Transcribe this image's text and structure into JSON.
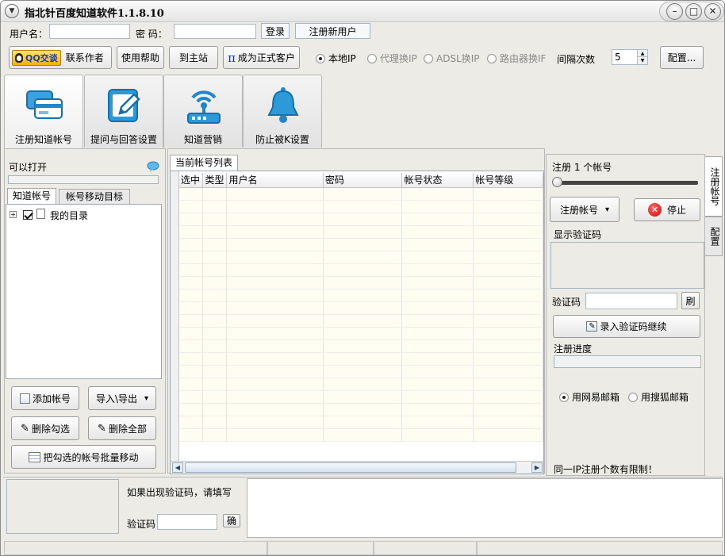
{
  "window": {
    "title": "指北针百度知道软件1.1.8.10"
  },
  "login": {
    "username_label": "用户名：",
    "username_value": "",
    "password_label": "密  码：",
    "password_value": "",
    "login_button": "登录",
    "register_button": "注册新用户"
  },
  "toolbar": {
    "qq_label": "QQ交谈",
    "contact_label": "联系作者",
    "help_button": "使用帮助",
    "home_button": "到主站",
    "pi_symbol": "π",
    "vip_button": "成为正式客户",
    "ip_options": [
      "本地IP",
      "代理换IP",
      "ADSL换IP",
      "路由器换IF"
    ],
    "interval_label": "间隔次数",
    "interval_value": "5",
    "config_button": "配置..."
  },
  "bigtabs": [
    {
      "label": "注册知道帐号",
      "icon": "card-icon"
    },
    {
      "label": "提问与回答设置",
      "icon": "edit-icon"
    },
    {
      "label": "知道营销",
      "icon": "wifi-router-icon"
    },
    {
      "label": "防止被K设置",
      "icon": "bell-icon"
    }
  ],
  "left": {
    "status_label": "可以打开",
    "tabs": [
      "知道帐号",
      "帐号移动目标"
    ],
    "tree_root": "我的目录",
    "add_button": "添加帐号",
    "import_button": "导入\\导出",
    "delete_checked_button": "删除勾选",
    "delete_all_button": "删除全部",
    "move_button": "把勾选的帐号批量移动"
  },
  "center": {
    "tab_label": "当前帐号列表",
    "columns": [
      "选中",
      "类型",
      "用户名",
      "密码",
      "帐号状态",
      "帐号等级"
    ]
  },
  "right": {
    "register_count_label": "注册 1 个帐号",
    "register_button": "注册帐号",
    "stop_button": "停止",
    "show_captcha_label": "显示验证码",
    "captcha_label": "验证码",
    "refresh_button": "刷",
    "continue_button": "录入验证码继续",
    "progress_label": "注册进度",
    "progress": 0,
    "mail_options": [
      "用网易邮箱",
      "用搜狐邮箱"
    ],
    "ip_limit_note": "同一IP注册个数有限制！",
    "vtabs": [
      "注册帐号",
      "配置"
    ]
  },
  "bottom": {
    "hint_text": "如果出现验证码，请填写",
    "captcha_label": "验证码",
    "confirm_button": "确"
  }
}
